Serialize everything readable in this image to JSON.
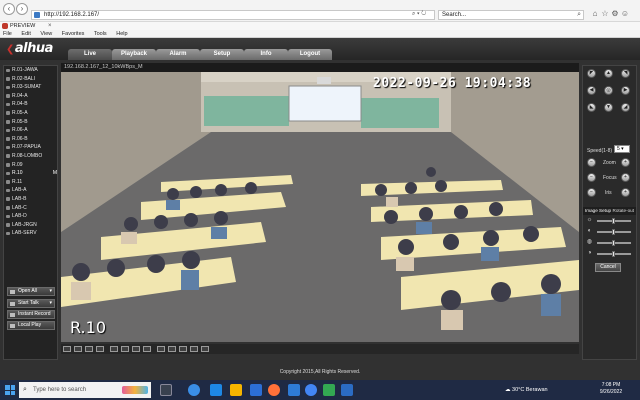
{
  "browser": {
    "url": "http://192.168.2.167/",
    "search_placeholder": "Search...",
    "tab_title": "PREVIEW",
    "menu": [
      "File",
      "Edit",
      "View",
      "Favorites",
      "Tools",
      "Help"
    ]
  },
  "app": {
    "logo_text": "alhua",
    "tabs": [
      {
        "label": "Live",
        "active": true
      },
      {
        "label": "Playback",
        "active": false
      },
      {
        "label": "Alarm",
        "active": false
      },
      {
        "label": "Setup",
        "active": false
      },
      {
        "label": "Info",
        "active": false
      },
      {
        "label": "Logout",
        "active": false
      }
    ],
    "channels": [
      {
        "label": "R.01-JAWA",
        "mark": ""
      },
      {
        "label": "R.02-BALI",
        "mark": ""
      },
      {
        "label": "R.03-SUMAT",
        "mark": ""
      },
      {
        "label": "R.04-A",
        "mark": ""
      },
      {
        "label": "R.04-B",
        "mark": ""
      },
      {
        "label": "R.05-A",
        "mark": ""
      },
      {
        "label": "R.05-B",
        "mark": ""
      },
      {
        "label": "R.06-A",
        "mark": ""
      },
      {
        "label": "R.06-B",
        "mark": ""
      },
      {
        "label": "R.07-PAPUA",
        "mark": ""
      },
      {
        "label": "R.08-LOMBO",
        "mark": ""
      },
      {
        "label": "R.09",
        "mark": ""
      },
      {
        "label": "R.10",
        "mark": "M",
        "selected": true
      },
      {
        "label": "R.11",
        "mark": ""
      },
      {
        "label": "LAB-A",
        "mark": ""
      },
      {
        "label": "LAB-B",
        "mark": ""
      },
      {
        "label": "LAB-C",
        "mark": ""
      },
      {
        "label": "LAB-D",
        "mark": ""
      },
      {
        "label": "LAB-JRGN",
        "mark": ""
      },
      {
        "label": "LAB-SERV",
        "mark": ""
      }
    ],
    "controls": {
      "open_all": "Open All",
      "start_talk": "Start Talk",
      "instant_record": "Instant Record",
      "local_play": "Local Play"
    },
    "video": {
      "header": "192.168.2.167_12_10kWBps_M",
      "timestamp": "2022-09-26 19:04:38",
      "camera_name": "R.10"
    },
    "ptz": {
      "speed_label": "Speed(1-8)",
      "speed_value": "5",
      "zoom_label": "Zoom",
      "focus_label": "Focus",
      "iris_label": "Iris",
      "image_setup_label": "Image Setup",
      "rotate_label": "Rotate-out",
      "cancel_label": "Cancel"
    },
    "copyright": "Copyright 2015,All Rights Reserved."
  },
  "taskbar": {
    "search_placeholder": "Type here to search",
    "weather": "30°C  Berawan",
    "time": "7:08 PM",
    "date": "9/26/2022"
  }
}
